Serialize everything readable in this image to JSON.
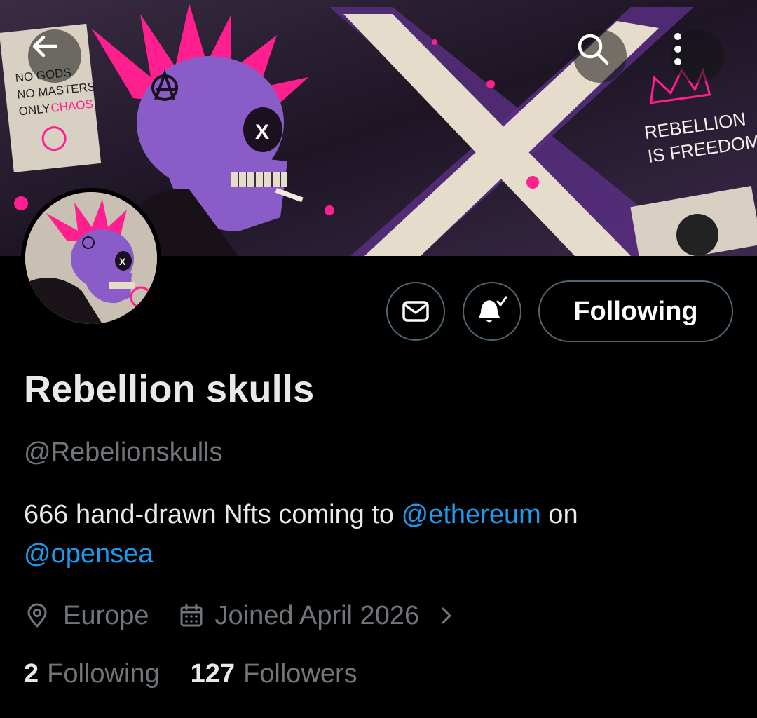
{
  "header": {
    "back_icon": "arrow-left-icon",
    "search_icon": "search-icon",
    "more_icon": "more-vertical-icon"
  },
  "banner": {
    "sign_left": [
      "NO GODS",
      "NO MASTERS",
      "ONLY CHAOS"
    ],
    "sign_right": [
      "REBELLION",
      "IS FREEDOM"
    ],
    "colors": {
      "purple": "#8a5cc7",
      "pink": "#ff1f8e",
      "cream": "#e6dccb"
    }
  },
  "actions": {
    "message_icon": "envelope-icon",
    "notify_icon": "bell-check-icon",
    "follow_label": "Following"
  },
  "profile": {
    "name": "Rebellion skulls",
    "handle": "@Rebelionskulls",
    "bio_before": "666 hand-drawn Nfts coming to ",
    "mention1": "@ethereum",
    "bio_mid": " on",
    "mention2": "@opensea",
    "location": "Europe",
    "joined": "Joined April 2026"
  },
  "stats": {
    "following_count": "2",
    "following_label": "Following",
    "followers_count": "127",
    "followers_label": "Followers"
  },
  "colors": {
    "accent": "#1d9bf0",
    "muted": "#71767b",
    "text": "#e7e9ea",
    "border": "#536471"
  }
}
